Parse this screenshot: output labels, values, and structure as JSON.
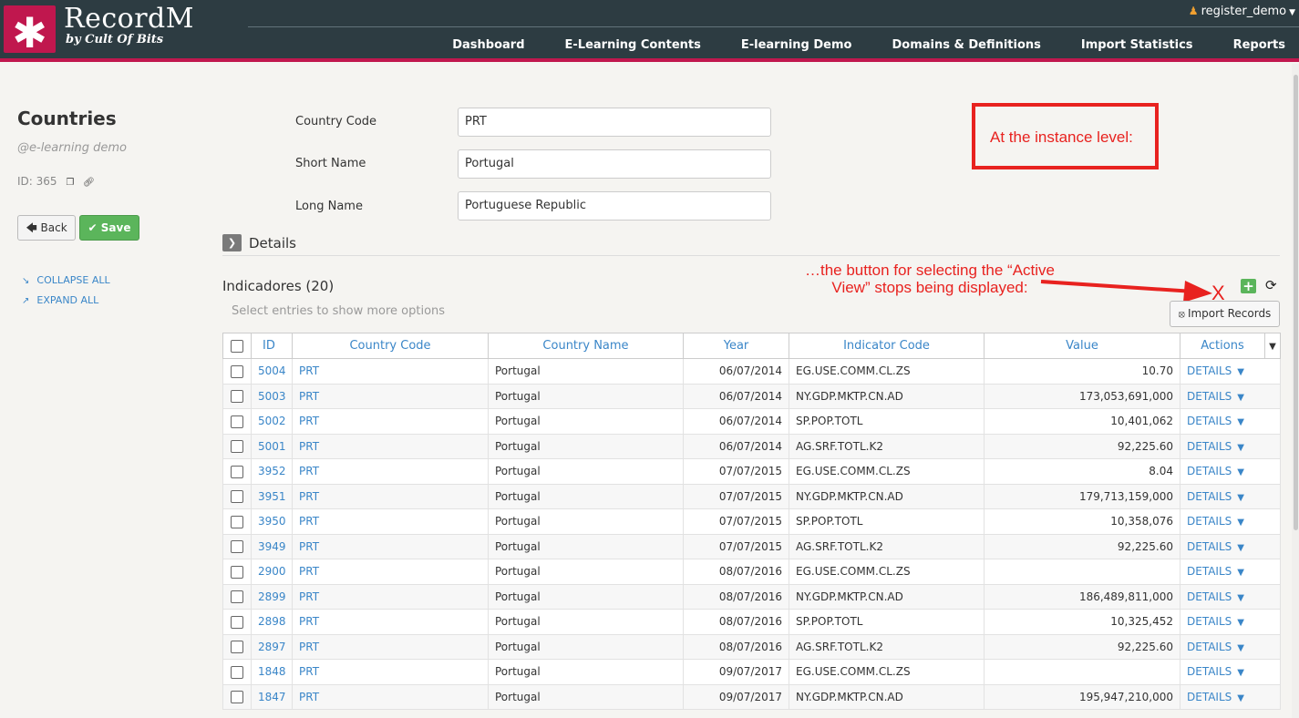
{
  "header": {
    "logo_symbol": "✱",
    "brand_name": "RecordM",
    "brand_sub": "by Cult Of Bits",
    "user": "register_demo",
    "nav": [
      "Dashboard",
      "E-Learning Contents",
      "E-learning Demo",
      "Domains & Definitions",
      "Import Statistics",
      "Reports"
    ]
  },
  "sidebar": {
    "title": "Countries",
    "subtitle": "@e-learning demo",
    "id_label": "ID: 365",
    "back_label": "Back",
    "save_label": "Save",
    "collapse_all": "COLLAPSE ALL",
    "expand_all": "EXPAND ALL"
  },
  "form": {
    "fields": [
      {
        "label": "Country Code",
        "value": "PRT"
      },
      {
        "label": "Short Name",
        "value": "Portugal"
      },
      {
        "label": "Long Name",
        "value": "Portuguese Republic"
      }
    ],
    "details_label": "Details"
  },
  "annotations": {
    "box_text": "At the instance level:",
    "arrow_text": "…the button for selecting the “Active View” stops being displayed:",
    "x_mark": "X",
    "color": "#e8221f"
  },
  "related": {
    "title": "Indicadores (20)",
    "select_hint": "Select entries to show more options",
    "import_label": "Import Records",
    "columns": [
      "ID",
      "Country Code",
      "Country Name",
      "Year",
      "Indicator Code",
      "Value",
      "Actions"
    ],
    "rows": [
      {
        "id": "5004",
        "code": "PRT",
        "name": "Portugal",
        "year": "06/07/2014",
        "indicator": "EG.USE.COMM.CL.ZS",
        "value": "10.70",
        "action": "DETAILS"
      },
      {
        "id": "5003",
        "code": "PRT",
        "name": "Portugal",
        "year": "06/07/2014",
        "indicator": "NY.GDP.MKTP.CN.AD",
        "value": "173,053,691,000",
        "action": "DETAILS"
      },
      {
        "id": "5002",
        "code": "PRT",
        "name": "Portugal",
        "year": "06/07/2014",
        "indicator": "SP.POP.TOTL",
        "value": "10,401,062",
        "action": "DETAILS"
      },
      {
        "id": "5001",
        "code": "PRT",
        "name": "Portugal",
        "year": "06/07/2014",
        "indicator": "AG.SRF.TOTL.K2",
        "value": "92,225.60",
        "action": "DETAILS"
      },
      {
        "id": "3952",
        "code": "PRT",
        "name": "Portugal",
        "year": "07/07/2015",
        "indicator": "EG.USE.COMM.CL.ZS",
        "value": "8.04",
        "action": "DETAILS"
      },
      {
        "id": "3951",
        "code": "PRT",
        "name": "Portugal",
        "year": "07/07/2015",
        "indicator": "NY.GDP.MKTP.CN.AD",
        "value": "179,713,159,000",
        "action": "DETAILS"
      },
      {
        "id": "3950",
        "code": "PRT",
        "name": "Portugal",
        "year": "07/07/2015",
        "indicator": "SP.POP.TOTL",
        "value": "10,358,076",
        "action": "DETAILS"
      },
      {
        "id": "3949",
        "code": "PRT",
        "name": "Portugal",
        "year": "07/07/2015",
        "indicator": "AG.SRF.TOTL.K2",
        "value": "92,225.60",
        "action": "DETAILS"
      },
      {
        "id": "2900",
        "code": "PRT",
        "name": "Portugal",
        "year": "08/07/2016",
        "indicator": "EG.USE.COMM.CL.ZS",
        "value": "",
        "action": "DETAILS"
      },
      {
        "id": "2899",
        "code": "PRT",
        "name": "Portugal",
        "year": "08/07/2016",
        "indicator": "NY.GDP.MKTP.CN.AD",
        "value": "186,489,811,000",
        "action": "DETAILS"
      },
      {
        "id": "2898",
        "code": "PRT",
        "name": "Portugal",
        "year": "08/07/2016",
        "indicator": "SP.POP.TOTL",
        "value": "10,325,452",
        "action": "DETAILS"
      },
      {
        "id": "2897",
        "code": "PRT",
        "name": "Portugal",
        "year": "08/07/2016",
        "indicator": "AG.SRF.TOTL.K2",
        "value": "92,225.60",
        "action": "DETAILS"
      },
      {
        "id": "1848",
        "code": "PRT",
        "name": "Portugal",
        "year": "09/07/2017",
        "indicator": "EG.USE.COMM.CL.ZS",
        "value": "",
        "action": "DETAILS"
      },
      {
        "id": "1847",
        "code": "PRT",
        "name": "Portugal",
        "year": "09/07/2017",
        "indicator": "NY.GDP.MKTP.CN.AD",
        "value": "195,947,210,000",
        "action": "DETAILS"
      }
    ]
  },
  "colors": {
    "header_bg": "#2d3c42",
    "brand_accent": "#c0174e",
    "link": "#3a86c8",
    "save_green": "#5bb55b"
  }
}
